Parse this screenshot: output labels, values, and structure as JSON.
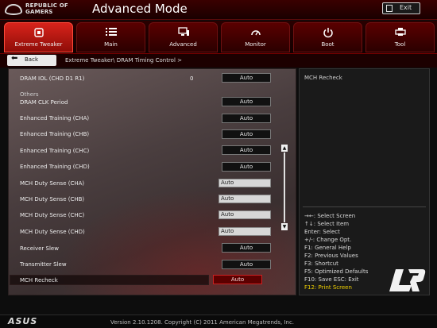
{
  "titlebar": {
    "brand_line1": "REPUBLIC OF",
    "brand_line2": "GAMERS",
    "mode_title": "Advanced Mode",
    "exit_label": "Exit"
  },
  "tabs": [
    {
      "label": "Extreme Tweaker",
      "icon": "chip-icon"
    },
    {
      "label": "Main",
      "icon": "list-icon"
    },
    {
      "label": "Advanced",
      "icon": "monitor-icon"
    },
    {
      "label": "Monitor",
      "icon": "gauge-icon"
    },
    {
      "label": "Boot",
      "icon": "power-icon"
    },
    {
      "label": "Tool",
      "icon": "printer-icon"
    }
  ],
  "active_tab": "Extreme Tweaker",
  "nav": {
    "back_label": "Back",
    "breadcrumb": "Extreme Tweaker\\ DRAM Timing Control >"
  },
  "settings": {
    "dram_iol": {
      "label": "DRAM IOL (CHD D1 R1)",
      "value": "0",
      "button": "Auto"
    },
    "others_label": "Others",
    "dram_clk_period": {
      "label": "DRAM CLK Period",
      "button": "Auto"
    },
    "enh_training_cha": {
      "label": "Enhanced Training (CHA)",
      "button": "Auto"
    },
    "enh_training_chb": {
      "label": "Enhanced Training (CHB)",
      "button": "Auto"
    },
    "enh_training_chc": {
      "label": "Enhanced Training (CHC)",
      "button": "Auto"
    },
    "enh_training_chd": {
      "label": "Enhanced Training (CHD)",
      "button": "Auto"
    },
    "mch_duty_cha": {
      "label": "MCH Duty Sense (CHA)",
      "input": "Auto"
    },
    "mch_duty_chb": {
      "label": "MCH Duty Sense (CHB)",
      "input": "Auto"
    },
    "mch_duty_chc": {
      "label": "MCH Duty Sense (CHC)",
      "input": "Auto"
    },
    "mch_duty_chd": {
      "label": "MCH Duty Sense (CHD)",
      "input": "Auto"
    },
    "receiver_slew": {
      "label": "Receiver Slew",
      "button": "Auto"
    },
    "transmitter_slew": {
      "label": "Transmitter Slew",
      "button": "Auto"
    },
    "mch_recheck": {
      "label": "MCH Recheck",
      "button": "Auto"
    }
  },
  "help": {
    "title": "MCH Recheck",
    "keys": [
      "→←: Select Screen",
      "↑↓: Select Item",
      "Enter: Select",
      "+/-: Change Opt.",
      "F1: General Help",
      "F2: Previous Values",
      "F3: Shortcut",
      "F5: Optimized Defaults",
      "F10: Save  ESC: Exit",
      "F12: Print Screen"
    ]
  },
  "footer": {
    "brand": "ASUS",
    "version": "Version 2.10.1208. Copyright (C) 2011 American Megatrends, Inc."
  },
  "colors": {
    "active_tab": "#d8231b",
    "selected_value": "#5c0000",
    "highlight_key": "#f0d000"
  }
}
